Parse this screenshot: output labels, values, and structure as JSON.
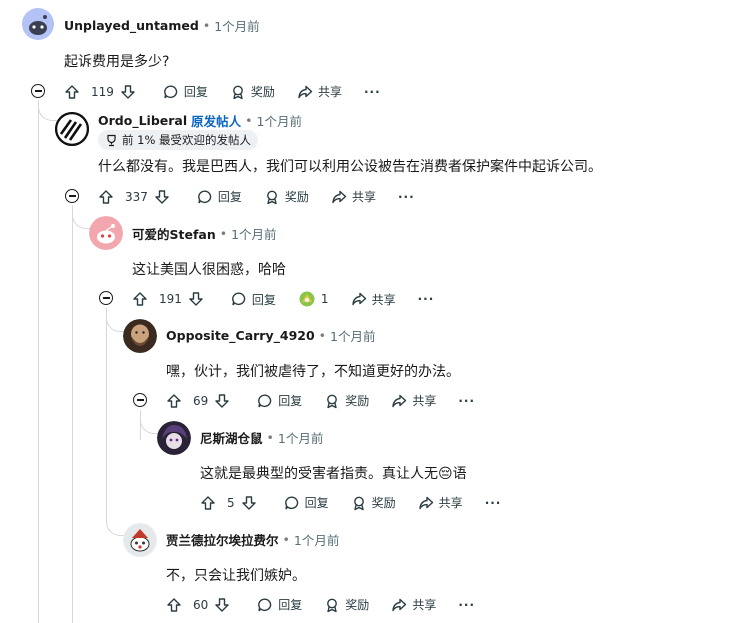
{
  "comments": [
    {
      "author": "Unplayed_untamed",
      "time": "1个月前",
      "body": "起诉费用是多少?",
      "votes": "119",
      "reply": "回复",
      "award": "奖励",
      "share": "共享",
      "more": "···"
    },
    {
      "author": "Ordo_Liberal",
      "op_tag": "原发帖人",
      "time": "1个月前",
      "flair": "前 1% 最受欢迎的发帖人",
      "body": "什么都没有。我是巴西人，我们可以利用公设被告在消费者保护案件中起诉公司。",
      "votes": "337",
      "reply": "回复",
      "award": "奖励",
      "share": "共享",
      "more": "···"
    },
    {
      "author": "可爱的Stefan",
      "time": "1个月前",
      "body": "这让美国人很困惑，哈哈",
      "votes": "191",
      "reply": "回复",
      "award_count": "1",
      "share": "共享",
      "more": "···"
    },
    {
      "author": "Opposite_Carry_4920",
      "time": "1个月前",
      "body": "嘿，伙计，我们被虐待了，不知道更好的办法。",
      "votes": "69",
      "reply": "回复",
      "award": "奖励",
      "share": "共享",
      "more": "···"
    },
    {
      "author": "尼斯湖仓鼠",
      "time": "1个月前",
      "body_before": "这就是最典型的受害者指责。真让人无",
      "emoji": "😔",
      "body_after": "语",
      "votes": "5",
      "reply": "回复",
      "award": "奖励",
      "share": "共享",
      "more": "···"
    },
    {
      "author": "贾兰德拉尔埃拉费尔",
      "time": "1个月前",
      "body": "不，只会让我们嫉妒。",
      "votes": "60",
      "reply": "回复",
      "award": "奖励",
      "share": "共享",
      "more": "···"
    }
  ],
  "colors": {
    "op_blue": "#0a65c2",
    "thread_line": "#d5d8dc"
  }
}
